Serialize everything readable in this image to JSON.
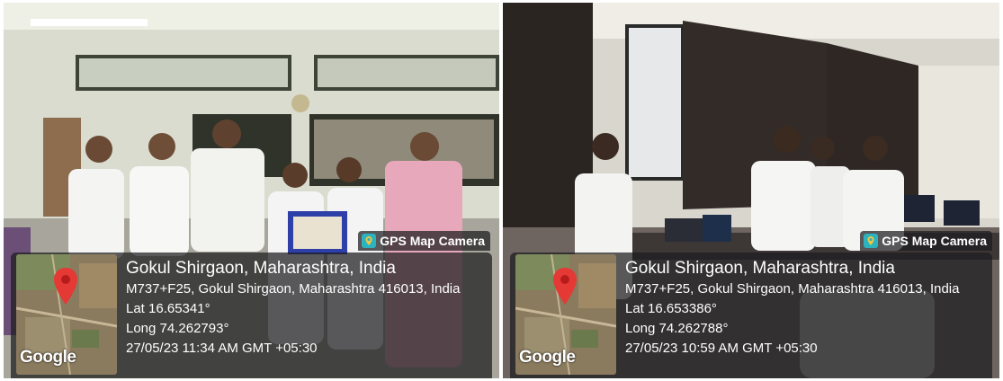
{
  "photos": [
    {
      "badge": "GPS Map Camera",
      "location": "Gokul Shirgaon, Maharashtra, India",
      "address": "M737+F25, Gokul Shirgaon, Maharashtra 416013, India",
      "lat": "Lat 16.65341°",
      "long": "Long 74.262793°",
      "datetime": "27/05/23 11:34 AM GMT +05:30",
      "map_brand": "Google",
      "icons": [
        "gps-map-camera-icon",
        "map-pin-icon"
      ]
    },
    {
      "badge": "GPS Map Camera",
      "location": "Gokul Shirgaon, Maharashtra, India",
      "address": "M737+F25, Gokul Shirgaon, Maharashtra 416013, India",
      "lat": "Lat 16.653386°",
      "long": "Long 74.262788°",
      "datetime": "27/05/23 10:59 AM GMT +05:30",
      "map_brand": "Google",
      "icons": [
        "gps-map-camera-icon",
        "map-pin-icon"
      ]
    }
  ],
  "colors": {
    "overlay": "#1c1c1e",
    "pin": "#e53935",
    "badge_icon": "#2bb3c0"
  }
}
